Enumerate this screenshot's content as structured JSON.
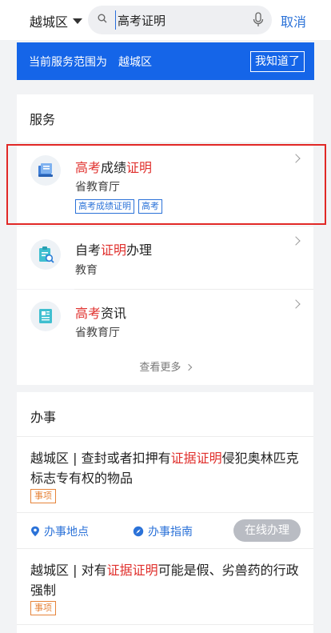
{
  "header": {
    "region": "越城区",
    "search_value": "高考证明",
    "cancel_label": "取消"
  },
  "banner": {
    "prefix": "当前服务范围为",
    "region": "越城区",
    "ok_label": "我知道了"
  },
  "services": {
    "section_title": "服务",
    "items": [
      {
        "title_parts": [
          {
            "text": "高考",
            "hl": true
          },
          {
            "text": "成绩",
            "hl": false
          },
          {
            "text": "证明",
            "hl": true
          }
        ],
        "dept": "省教育厅",
        "tags": [
          "高考成绩证明",
          "高考"
        ],
        "icon": "id-card-icon"
      },
      {
        "title_parts": [
          {
            "text": "自考",
            "hl": false
          },
          {
            "text": "证明",
            "hl": true
          },
          {
            "text": "办理",
            "hl": false
          }
        ],
        "dept": "教育",
        "tags": [],
        "icon": "clipboard-search-icon"
      },
      {
        "title_parts": [
          {
            "text": "高考",
            "hl": true
          },
          {
            "text": "资讯",
            "hl": false
          }
        ],
        "dept": "省教育厅",
        "tags": [],
        "icon": "news-document-icon"
      }
    ],
    "more_label": "查看更多"
  },
  "affairs": {
    "section_title": "办事",
    "items": [
      {
        "title_parts": [
          {
            "text": "越城区 | 查封或者扣押有",
            "hl": false
          },
          {
            "text": "证据证明",
            "hl": true
          },
          {
            "text": "侵犯奥林匹克标志专有权的物品",
            "hl": false
          }
        ],
        "tag": "事项",
        "location_label": "办事地点",
        "guide_label": "办事指南",
        "online_label": "在线办理"
      },
      {
        "title_parts": [
          {
            "text": "越城区 | 对有",
            "hl": false
          },
          {
            "text": "证据证明",
            "hl": true
          },
          {
            "text": "可能是假、劣兽药的行政强制",
            "hl": false
          }
        ],
        "tag": "事项"
      }
    ]
  },
  "colors": {
    "accent": "#1565e8",
    "highlight": "#e0302d",
    "tag_orange": "#e6843a",
    "selection_box": "#e12826"
  }
}
